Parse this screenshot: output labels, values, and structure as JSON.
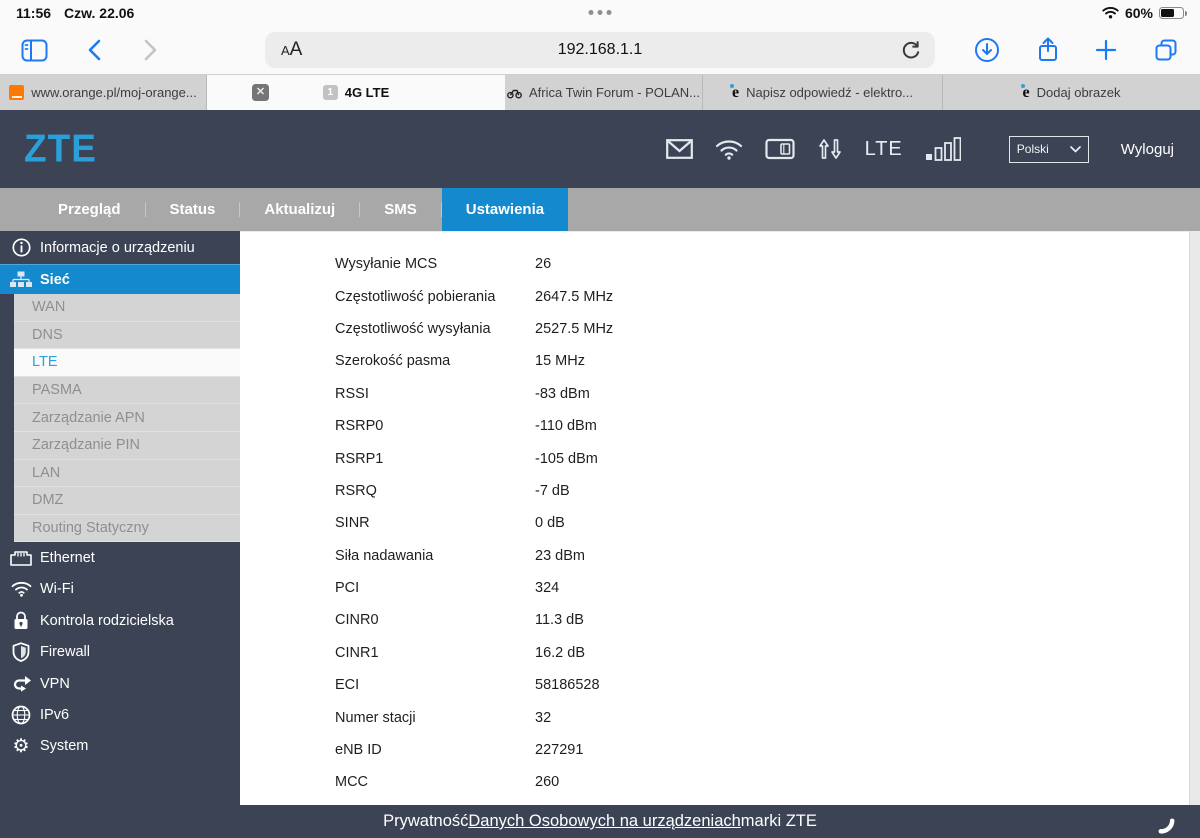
{
  "status_bar": {
    "time": "11:56",
    "date": "Czw. 22.06",
    "battery_percent": "60%"
  },
  "browser": {
    "reader_button": "AA",
    "url": "192.168.1.1",
    "close_tab_glyph": "✕",
    "tabs": [
      {
        "label": "www.orange.pl/moj-orange..."
      },
      {
        "label": "4G LTE",
        "favicon_glyph": "1"
      },
      {
        "label": "Africa Twin Forum - POLAN..."
      },
      {
        "label": "Napisz odpowiedź - elektro...",
        "favicon_glyph": "e"
      },
      {
        "label": "Dodaj obrazek",
        "favicon_glyph": "e"
      }
    ]
  },
  "zte_header": {
    "logo": "ZTE",
    "network_badge": "LTE",
    "language": "Polski",
    "logout": "Wyloguj"
  },
  "nav": {
    "items": [
      {
        "label": "Przegląd"
      },
      {
        "label": "Status"
      },
      {
        "label": "Aktualizuj"
      },
      {
        "label": "SMS"
      },
      {
        "label": "Ustawienia"
      }
    ],
    "active": "Ustawienia"
  },
  "sidebar": {
    "device_info": "Informacje o urządzeniu",
    "network": "Sieć",
    "submenu": [
      {
        "label": "WAN"
      },
      {
        "label": "DNS"
      },
      {
        "label": "LTE"
      },
      {
        "label": "PASMA"
      },
      {
        "label": "Zarządzanie APN"
      },
      {
        "label": "Zarządzanie PIN"
      },
      {
        "label": "LAN"
      },
      {
        "label": "DMZ"
      },
      {
        "label": "Routing Statyczny"
      }
    ],
    "active_submenu": "LTE",
    "items": [
      {
        "label": "Ethernet"
      },
      {
        "label": "Wi-Fi"
      },
      {
        "label": "Kontrola rodzicielska"
      },
      {
        "label": "Firewall"
      },
      {
        "label": "VPN"
      },
      {
        "label": "IPv6"
      },
      {
        "label": "System"
      }
    ]
  },
  "lte_status": {
    "rows": [
      {
        "label": "Wysyłanie MCS",
        "value": "26"
      },
      {
        "label": "Częstotliwość pobierania",
        "value": "2647.5 MHz"
      },
      {
        "label": "Częstotliwość wysyłania",
        "value": "2527.5 MHz"
      },
      {
        "label": "Szerokość pasma",
        "value": "15 MHz"
      },
      {
        "label": "RSSI",
        "value": "-83 dBm"
      },
      {
        "label": "RSRP0",
        "value": "-110 dBm"
      },
      {
        "label": "RSRP1",
        "value": "-105 dBm"
      },
      {
        "label": "RSRQ",
        "value": "-7 dB"
      },
      {
        "label": "SINR",
        "value": "0 dB"
      },
      {
        "label": "Siła nadawania",
        "value": "23 dBm"
      },
      {
        "label": "PCI",
        "value": "324"
      },
      {
        "label": "CINR0",
        "value": "11.3 dB"
      },
      {
        "label": "CINR1",
        "value": "16.2 dB"
      },
      {
        "label": "ECI",
        "value": "58186528"
      },
      {
        "label": "Numer stacji",
        "value": "32"
      },
      {
        "label": "eNB ID",
        "value": "227291"
      },
      {
        "label": "MCC",
        "value": "260"
      }
    ]
  },
  "footer": {
    "prefix": "Prywatność ",
    "link": "Danych Osobowych na urządzeniach",
    "suffix": " marki ZTE"
  },
  "colors": {
    "accent_blue": "#1489cd",
    "header_dark": "#3b4354",
    "logo_blue": "#2b9fd8",
    "ios_blue": "#007aff",
    "nav_gray": "#a8a8a8",
    "active_link_blue": "#29a2dc",
    "orange_brand": "#ff7900"
  }
}
